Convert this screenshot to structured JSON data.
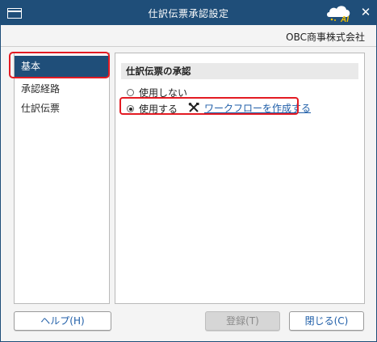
{
  "window": {
    "title": "仕訳伝票承認設定",
    "company": "OBC商事株式会社",
    "close_glyph": "✕",
    "logo_text": "AI"
  },
  "nav": {
    "items": [
      {
        "label": "基本"
      },
      {
        "label": "承認経路"
      },
      {
        "label": "仕訳伝票"
      }
    ]
  },
  "section": {
    "title": "仕訳伝票の承認",
    "options": [
      {
        "label": "使用しない",
        "selected": false
      },
      {
        "label": "使用する",
        "selected": true
      }
    ],
    "workflow_link": "ワークフローを作成する"
  },
  "buttons": {
    "help": "ヘルプ(H)",
    "register": "登録(T)",
    "close": "閉じる(C)"
  },
  "colors": {
    "titlebar": "#1f4e79",
    "highlight": "#e31b23",
    "link": "#1f5ea8"
  }
}
